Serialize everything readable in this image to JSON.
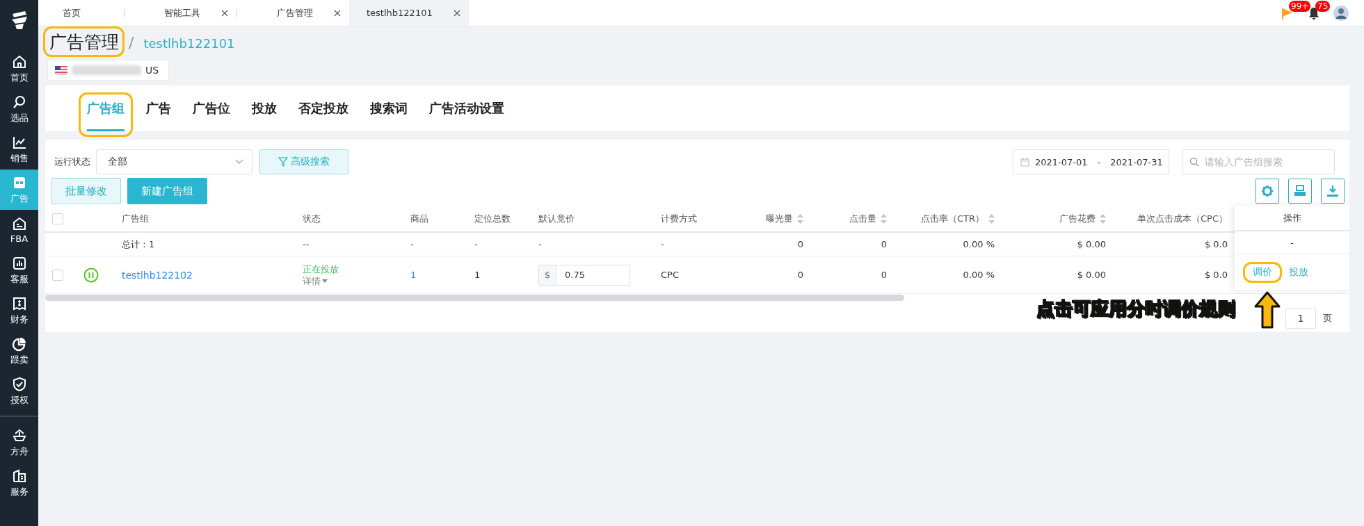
{
  "top_tabs": [
    {
      "label": "首页",
      "closable": false,
      "selected": false
    },
    {
      "label": "智能工具",
      "closable": true,
      "selected": false
    },
    {
      "label": "广告管理",
      "closable": true,
      "selected": false
    },
    {
      "label": "testlhb122101",
      "closable": true,
      "selected": true
    }
  ],
  "notifications": [
    {
      "kind": "flag",
      "badge": "99+"
    },
    {
      "kind": "bell",
      "badge": "75"
    }
  ],
  "sidebar": {
    "groups": [
      [
        {
          "label": "首页",
          "selected": false
        },
        {
          "label": "选品",
          "selected": false
        },
        {
          "label": "销售",
          "selected": false
        },
        {
          "label": "广告",
          "selected": true
        },
        {
          "label": "FBA",
          "selected": false
        },
        {
          "label": "客服",
          "selected": false
        },
        {
          "label": "财务",
          "selected": false
        },
        {
          "label": "跟卖",
          "selected": false
        },
        {
          "label": "授权",
          "selected": false
        }
      ],
      [
        {
          "label": "方舟",
          "selected": false
        },
        {
          "label": "服务",
          "selected": false
        }
      ]
    ]
  },
  "breadcrumb": {
    "title": "广告管理",
    "highlighted": true,
    "separator": "/",
    "current": "testlhb122101"
  },
  "store": {
    "name": "US"
  },
  "section_tabs": [
    {
      "label": "广告组",
      "selected": true,
      "highlighted": true
    },
    {
      "label": "广告",
      "selected": false,
      "highlighted": false
    },
    {
      "label": "广告位",
      "selected": false,
      "highlighted": false
    },
    {
      "label": "投放",
      "selected": false,
      "highlighted": false
    },
    {
      "label": "否定投放",
      "selected": false,
      "highlighted": false
    },
    {
      "label": "搜索词",
      "selected": false,
      "highlighted": false
    },
    {
      "label": "广告活动设置",
      "selected": false,
      "highlighted": false
    }
  ],
  "filters": {
    "status_label": "运行状态",
    "status_value": "全部",
    "advanced_search": "高级搜索",
    "date_from": "2021-07-01",
    "date_separator": "-",
    "date_to": "2021-07-31",
    "search_placeholder": "请输入广告组搜索"
  },
  "buttons": [
    {
      "label": "批量修改",
      "kind": "outline"
    },
    {
      "label": "新建广告组",
      "kind": "primary"
    }
  ],
  "table": {
    "header_checked": false,
    "columns": [
      {
        "label": "广告组",
        "sortable": false
      },
      {
        "label": "状态",
        "sortable": false
      },
      {
        "label": "商品",
        "sortable": false
      },
      {
        "label": "定位总数",
        "sortable": false
      },
      {
        "label": "默认竟价",
        "sortable": false
      },
      {
        "label": "计费方式",
        "sortable": false
      },
      {
        "label": "曝光量",
        "sortable": true
      },
      {
        "label": "点击量",
        "sortable": true
      },
      {
        "label": "点击率（CTR）",
        "sortable": true
      },
      {
        "label": "广告花费",
        "sortable": true
      },
      {
        "label": "单次点击成本（CPC）",
        "sortable": false
      },
      {
        "label": "操作",
        "sortable": false
      }
    ],
    "total_row": {
      "label": "总计：1",
      "cells": [
        "--",
        "-",
        "-",
        "-",
        "-",
        "0",
        "0",
        "0.00 %",
        "$ 0.00",
        "$ 0.0",
        "-"
      ]
    },
    "rows": [
      {
        "checked": false,
        "name": "testlhb122102",
        "status": "正在投放",
        "details": "详情",
        "products": "1",
        "targets": "1",
        "bid_prefix": "$",
        "bid": "0.75",
        "billing": "CPC",
        "impressions": "0",
        "clicks": "0",
        "ctr": "0.00 %",
        "spend": "$ 0.00",
        "cpc": "$ 0.0",
        "actions": [
          {
            "label": "调价",
            "highlighted": true
          },
          {
            "label": "投放",
            "highlighted": false
          }
        ]
      }
    ]
  },
  "pagination": {
    "page": "1",
    "suffix": "页"
  },
  "callout": {
    "text": "点击可应用分时调价规则"
  }
}
